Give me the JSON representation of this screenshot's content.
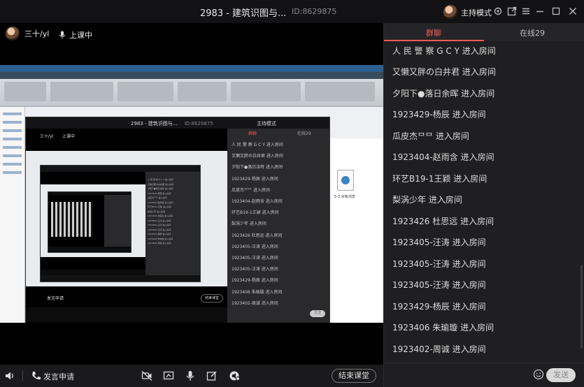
{
  "titlebar": {
    "title": "2983 - 建筑识图与...",
    "room_id": "ID:8629875",
    "mode": "主持模式"
  },
  "presenter": {
    "name": "三十/yl",
    "status": "上课中"
  },
  "share": {
    "file_label": "5-3 对象浏览"
  },
  "nested_large": {
    "title": "2983 - 建筑识图与...",
    "room_id": "ID:8629875",
    "presenter": "三十/yl",
    "status": "上课中",
    "mode": "主持模式",
    "tab_chat": "群聊",
    "tab_online": "在线29",
    "speak": "发言申请",
    "end": "结束课堂",
    "send": "发送",
    "lines": [
      "人 民 警 察 G C Y 进入房间",
      "又懒又胖の白井君 进入房间",
      "夕阳下●落日余晖 进入房间",
      "1923429-杨辰 进入房间",
      "瓜皮杰ᄆᄆ 进入房间",
      "1923404-赵雨含 进入房间",
      "环艺B19-1王颖 进入房间",
      "梨涡少年 进入房间",
      "1923426 杜思远 进入房间",
      "1923405-汪涛 进入房间",
      "1923405-汪涛 进入房间",
      "1923405-汪涛 进入房间",
      "1923429-杨辰 进入房间",
      "1923406  朱瑜璇 进入房间",
      "1923402-周诚 进入房间"
    ]
  },
  "toolbar": {
    "speak_label": "发言申请",
    "end_label": "结束课堂"
  },
  "panel": {
    "tab_chat": "群聊",
    "tab_online": "在线29",
    "send_label": "发送",
    "input_placeholder": "",
    "messages": [
      "人 民 警 察 G C Y 进入房间",
      "又懒又胖の白井君 进入房间",
      "夕阳下●落日余晖 进入房间",
      "1923429-杨辰 进入房间",
      "瓜皮杰ᄆᄆ 进入房间",
      "1923404-赵雨含 进入房间",
      "环艺B19-1王颖 进入房间",
      "梨涡少年 进入房间",
      "1923426 杜思远 进入房间",
      "1923405-汪涛 进入房间",
      "1923405-汪涛 进入房间",
      "1923405-汪涛 进入房间",
      "1923429-杨辰 进入房间",
      "1923406  朱瑜璇 进入房间",
      "1923402-周诚 进入房间"
    ]
  },
  "colors": {
    "accent": "#f05a5a",
    "panel_bg": "#1f1f21",
    "video_bg": "#000000"
  }
}
